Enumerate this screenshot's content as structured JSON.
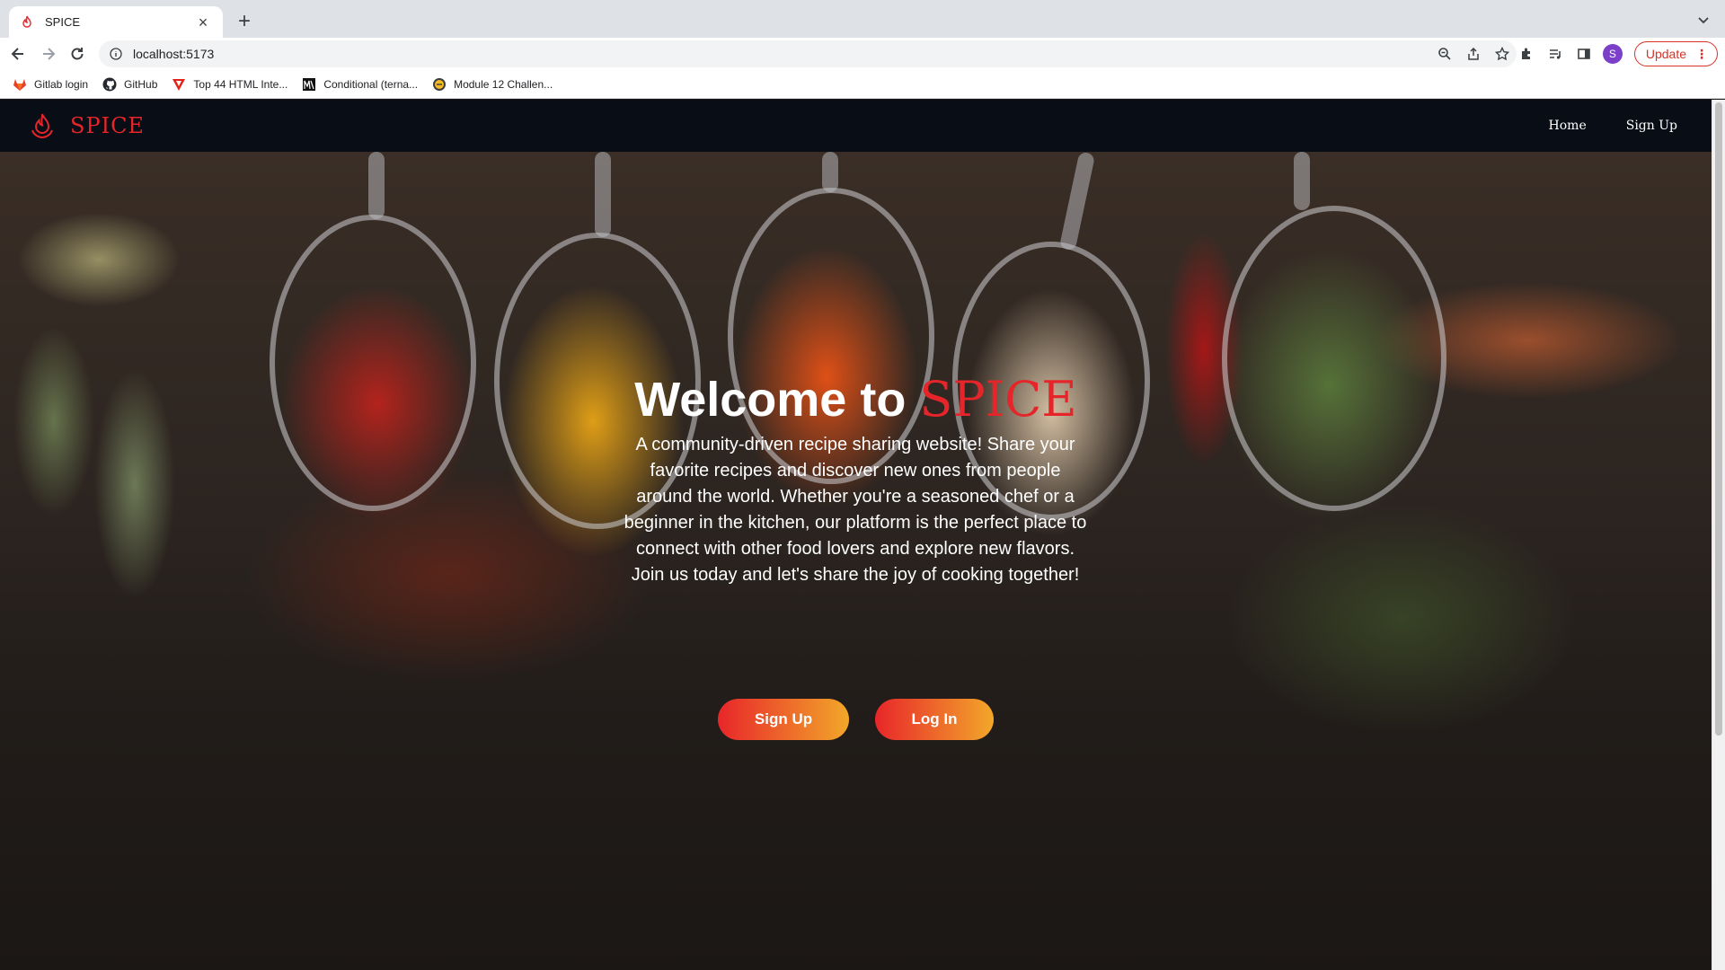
{
  "browser": {
    "tab_title": "SPICE",
    "url": "localhost:5173",
    "profile_initial": "S",
    "update_label": "Update",
    "bookmarks": [
      {
        "label": "Gitlab login",
        "icon": "gitlab-icon"
      },
      {
        "label": "GitHub",
        "icon": "github-icon"
      },
      {
        "label": "Top 44 HTML Inte...",
        "icon": "v-logo-icon"
      },
      {
        "label": "Conditional (terna...",
        "icon": "m-logo-icon"
      },
      {
        "label": "Module 12 Challen...",
        "icon": "badge-icon"
      }
    ]
  },
  "site": {
    "brand": "SPICE",
    "nav": {
      "home": "Home",
      "signup": "Sign Up"
    },
    "hero": {
      "title_prefix": "Welcome to",
      "title_brand": "SPICE",
      "description": "A community-driven recipe sharing website! Share your favorite recipes and discover new ones from people around the world. Whether you're a seasoned chef or a beginner in the kitchen, our platform is the perfect place to connect with other food lovers and explore new flavors. Join us today and let's share the joy of cooking together!",
      "signup_button": "Sign Up",
      "login_button": "Log In"
    }
  },
  "colors": {
    "brand_red": "#e5252a",
    "button_gradient_start": "#e8262a",
    "button_gradient_end": "#f2a72a",
    "nav_background": "#080d16"
  }
}
